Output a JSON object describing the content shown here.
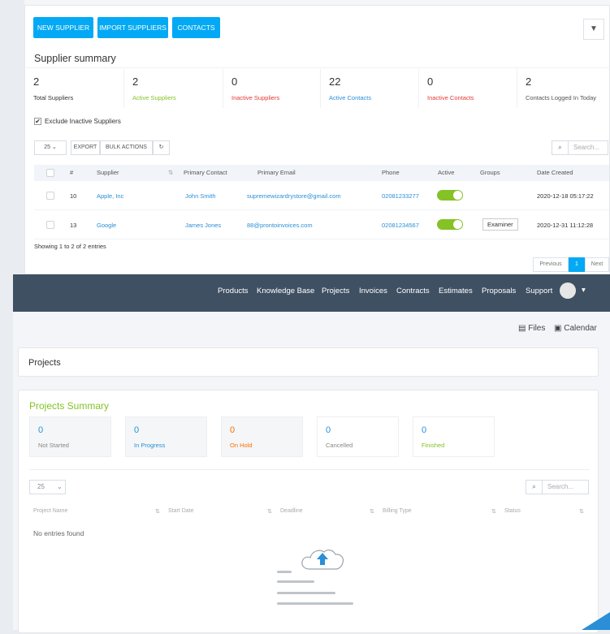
{
  "toolbar": {
    "new_supplier": "NEW SUPPLIER",
    "import_suppliers": "IMPORT SUPPLIERS",
    "contacts": "CONTACTS",
    "filter_icon": "filter-icon"
  },
  "supplier_summary": {
    "title": "Supplier summary",
    "stats": [
      {
        "value": "2",
        "label": "Total Suppliers",
        "color": "#333333"
      },
      {
        "value": "2",
        "label": "Active Suppliers",
        "color": "#84c225"
      },
      {
        "value": "0",
        "label": "Inactive Suppliers",
        "color": "#e53935"
      },
      {
        "value": "22",
        "label": "Active Contacts",
        "color": "#2a8fd6"
      },
      {
        "value": "0",
        "label": "Inactive Contacts",
        "color": "#e53935"
      },
      {
        "value": "2",
        "label": "Contacts Logged In Today",
        "color": "#555555"
      }
    ]
  },
  "filters": {
    "exclude_inactive": "Exclude Inactive Suppliers",
    "checked": true
  },
  "table_tools": {
    "page_size": "25",
    "export": "EXPORT",
    "bulk_actions": "BULK ACTIONS",
    "search_placeholder": "Search..."
  },
  "suppliers_table": {
    "columns": [
      "#",
      "Supplier",
      "Primary Contact",
      "Primary Email",
      "Phone",
      "Active",
      "Groups",
      "Date Created"
    ],
    "rows": [
      {
        "id": "10",
        "supplier": "Apple, Inc",
        "contact": "John Smith",
        "email": "supremewizardrystore@gmail.com",
        "phone": "02081233277",
        "active": true,
        "group": "",
        "created": "2020-12-18 05:17:22"
      },
      {
        "id": "13",
        "supplier": "Google",
        "contact": "James Jones",
        "email": "88@prontoinvoices.com",
        "phone": "02081234567",
        "active": true,
        "group": "Examiner",
        "created": "2020-12-31 11:12:28"
      }
    ],
    "info": "Showing 1 to 2 of 2 entries",
    "pagination": {
      "previous": "Previous",
      "current": "1",
      "next": "Next"
    }
  },
  "navbar": {
    "items": [
      "Products",
      "Knowledge Base",
      "Projects",
      "Invoices",
      "Contracts",
      "Estimates",
      "Proposals",
      "Support"
    ],
    "caret": "▾"
  },
  "client_area": {
    "files": "Files",
    "calendar": "Calendar",
    "projects_heading": "Projects",
    "summary_title": "Projects Summary",
    "summary": [
      {
        "value": "0",
        "label": "Not Started",
        "color": "#2a8fd6",
        "label_color": "#888888"
      },
      {
        "value": "0",
        "label": "In Progress",
        "color": "#2a8fd6",
        "label_color": "#2a8fd6"
      },
      {
        "value": "0",
        "label": "On Hold",
        "color": "#ff6f00",
        "label_color": "#ff6f00"
      },
      {
        "value": "0",
        "label": "Cancelled",
        "color": "#2a8fd6",
        "label_color": "#888888"
      },
      {
        "value": "0",
        "label": "Finished",
        "color": "#2a8fd6",
        "label_color": "#84c225"
      }
    ],
    "page_size": "25",
    "search_placeholder": "Search...",
    "columns": [
      "Project Name",
      "Start Date",
      "Deadline",
      "Billing Type",
      "Status"
    ],
    "empty": "No entries found"
  }
}
